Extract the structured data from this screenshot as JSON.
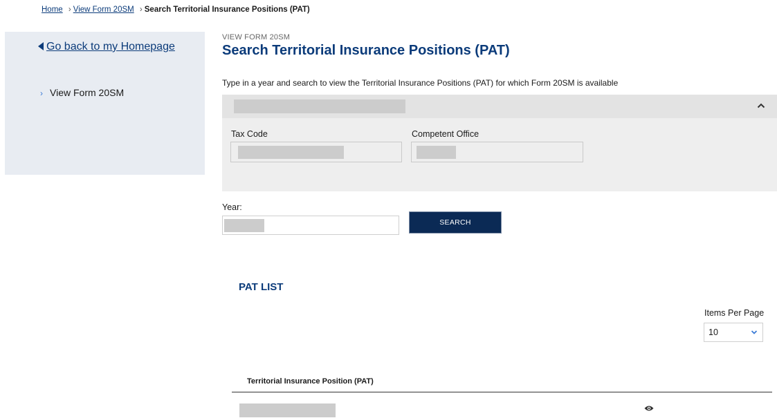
{
  "breadcrumb": {
    "items": [
      "Home",
      "View Form 20SM"
    ],
    "current": "Search Territorial Insurance Positions (PAT)"
  },
  "sidebar": {
    "back_label": "Go back to my Homepage",
    "items": [
      {
        "label": "View Form 20SM"
      }
    ]
  },
  "header": {
    "overline": "VIEW FORM 20SM",
    "title": "Search Territorial Insurance Positions (PAT)",
    "intro": "Type in a year and search to view the Territorial Insurance Positions (PAT) for which Form 20SM is available"
  },
  "panel": {
    "tax_code_label": "Tax Code",
    "competent_office_label": "Competent Office"
  },
  "search": {
    "year_label": "Year:",
    "button_label": "SEARCH"
  },
  "list": {
    "title": "PAT LIST",
    "items_per_page_label": "Items Per Page",
    "items_per_page_value": "10",
    "column_header": "Territorial Insurance Position (PAT)"
  },
  "icons": {
    "back": "triangle-left-icon",
    "collapse": "chevron-up-icon",
    "nav": "chevron-right-icon",
    "select": "chevron-down-icon",
    "view": "eye-icon"
  },
  "colors": {
    "primary": "#0b3b7a",
    "button": "#0b2a55",
    "accent": "#3b7bd6",
    "sidebar_bg": "#e8ecf2",
    "panel_bg": "#eeeeee",
    "redaction": "#cccccc"
  }
}
